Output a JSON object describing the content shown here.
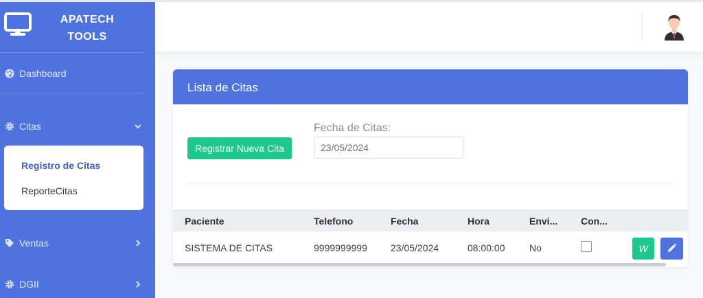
{
  "sidebar": {
    "brand": "APATECH\nTOOLS",
    "brand_icon": "monitor-icon",
    "items": [
      {
        "label": "Dashboard",
        "icon": "palette-icon"
      },
      {
        "label": "Citas",
        "icon": "gear-icon"
      },
      {
        "label": "Ventas",
        "icon": "tag-icon"
      },
      {
        "label": "DGII",
        "icon": "gear-icon"
      }
    ],
    "submenu": [
      "Registro de Citas",
      "ReporteCitas"
    ]
  },
  "topbar": {
    "avatar_icon": "user-avatar-icon"
  },
  "card": {
    "title": "Lista de Citas",
    "new_button": "Registrar Nueva Cita",
    "date_label": "Fecha de Citas:",
    "date_value": "23/05/2024"
  },
  "table": {
    "headers": [
      "Paciente",
      "Telefono",
      "Fecha",
      "Hora",
      "Envi...",
      "Con..."
    ],
    "rows": [
      {
        "paciente": "SISTEMA DE CITAS",
        "telefono": "9999999999",
        "fecha": "23/05/2024",
        "hora": "08:00:00",
        "enviado": "No",
        "confirmado": false,
        "whatsapp_label": "W"
      }
    ]
  },
  "colors": {
    "primary": "#4e73df",
    "success": "#1cc88a",
    "background": "#f6f8fb"
  }
}
